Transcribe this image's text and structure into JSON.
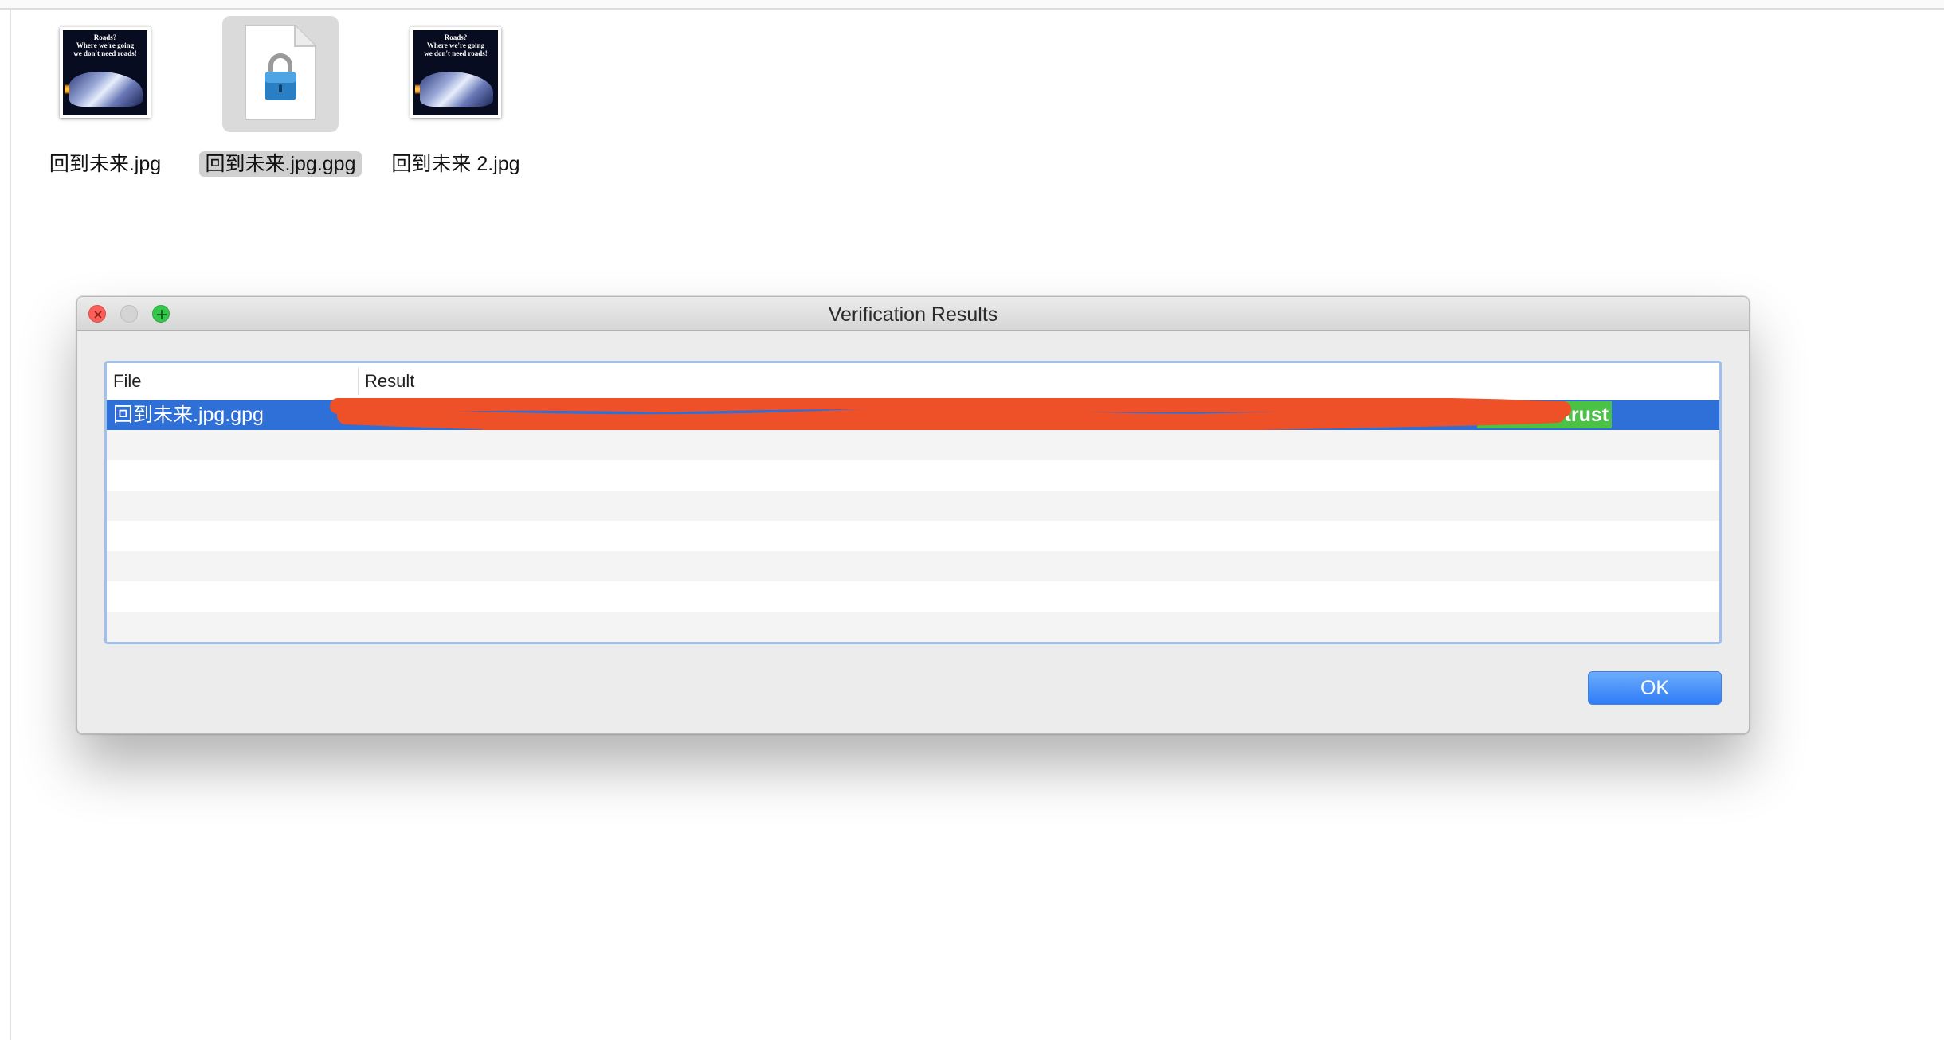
{
  "desktop": {
    "files": [
      {
        "name": "回到未来.jpg",
        "kind": "image",
        "selected": false,
        "poster_text": "Roads?\nWhere we're going\nwe don't need roads!"
      },
      {
        "name": "回到未来.jpg.gpg",
        "kind": "encrypted-document",
        "selected": true,
        "icon": "lock-icon"
      },
      {
        "name": "回到未来 2.jpg",
        "kind": "image",
        "selected": false,
        "poster_text": "Roads?\nWhere we're going\nwe don't need roads!"
      }
    ]
  },
  "dialog": {
    "title": "Verification Results",
    "window_controls": [
      "close",
      "minimize",
      "zoom"
    ],
    "table": {
      "columns": [
        "File",
        "Result"
      ],
      "rows": [
        {
          "file": "回到未来.jpg.gpg",
          "result_redacted": true,
          "trust": "Ultimate trust",
          "selected": true
        }
      ],
      "empty_rows": 7
    },
    "ok_label": "OK"
  },
  "colors": {
    "selection": "#2f6fd8",
    "trust_badge": "#4ac246",
    "redaction": "#ee5028",
    "ok_button": "#2f7cf6",
    "focus_ring": "#9fc0ec"
  }
}
